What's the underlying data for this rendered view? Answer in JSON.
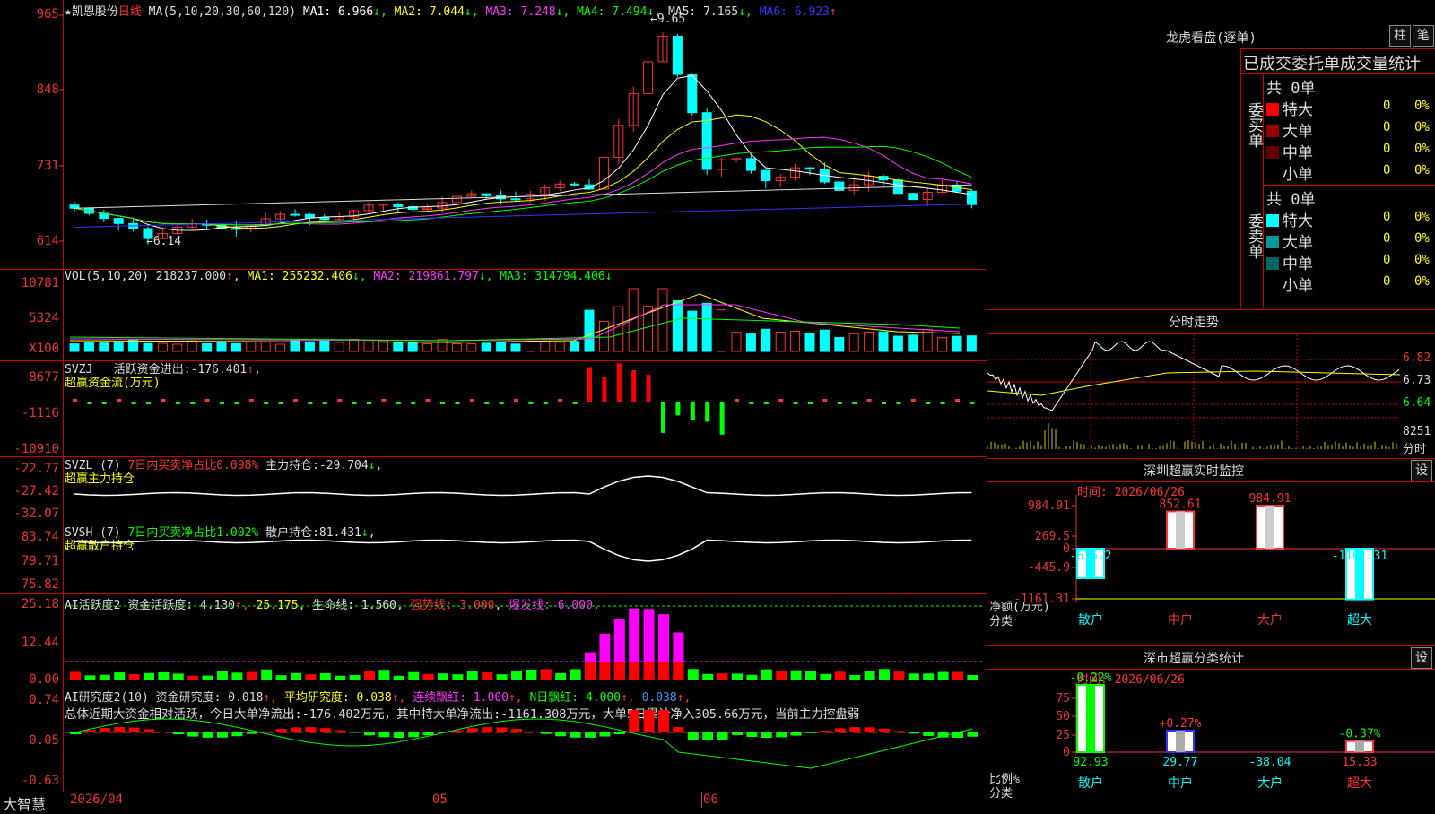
{
  "main": {
    "stock_name": "★凯恩股份",
    "period": "日线",
    "ma_label": "MA(5,10,20,30,60,120)",
    "ma": [
      {
        "name": "MA1:",
        "value": "6.966",
        "arrow": "↓",
        "color": "#ffffff"
      },
      {
        "name": "MA2:",
        "value": "7.044",
        "arrow": "↓",
        "color": "#ffff00"
      },
      {
        "name": "MA3:",
        "value": "7.248",
        "arrow": "↓",
        "color": "#ff33ff"
      },
      {
        "name": "MA4:",
        "value": "7.494",
        "arrow": "↓",
        "color": "#00ff00"
      },
      {
        "name": "MA5:",
        "value": "7.165",
        "arrow": "↓",
        "color": "#dddddd"
      },
      {
        "name": "MA6:",
        "value": "6.923",
        "arrow": "↑",
        "color": "#3333ff"
      }
    ],
    "y_labels": [
      "965",
      "848",
      "731",
      "614"
    ],
    "high_marker": "9.65",
    "low_marker": "6.14"
  },
  "vol": {
    "title": "VOL(5,10,20)",
    "value": "218237.000",
    "ma": [
      {
        "name": "MA1:",
        "value": "255232.406",
        "arrow": "↓",
        "color": "#ffff00"
      },
      {
        "name": "MA2:",
        "value": "219861.797",
        "arrow": "↓",
        "color": "#ff33ff"
      },
      {
        "name": "MA3:",
        "value": "314794.406",
        "arrow": "↓",
        "color": "#00ff00"
      }
    ],
    "y_labels": [
      "10781",
      "5324",
      "X100"
    ]
  },
  "svzj": {
    "title": "SVZJ",
    "line1_label": "活跃资金进出:",
    "line1_value": "-176.401",
    "line2": "超赢资金流(万元)",
    "y_labels": [
      "8677",
      "-1116",
      "-10910"
    ]
  },
  "svzl": {
    "title": "SVZL (7)",
    "seg1": "7日内买卖净占比0.098%",
    "seg2_label": "主力持仓:",
    "seg2_value": "-29.704",
    "line2": "超赢主力持仓",
    "y_labels": [
      "-22.77",
      "-27.42",
      "-32.07"
    ]
  },
  "svsh": {
    "title": "SVSH (7)",
    "seg1": "7日内买卖净占比1.002%",
    "seg2_label": "散户持仓:",
    "seg2_value": "81.431",
    "line2": "超赢散户持仓",
    "y_labels": [
      "83.74",
      "79.71",
      "75.82"
    ]
  },
  "ai1": {
    "title": "AI活跃度2",
    "items": [
      {
        "label": "资金活跃度:",
        "value": "4.130",
        "arrow": "↑",
        "color": "#dddddd"
      },
      {
        "label": "",
        "value": "25.175",
        "arrow": ",",
        "color": "#ffff00"
      },
      {
        "label": "生命线:",
        "value": "1.560",
        "arrow": ",",
        "color": "#dddddd"
      },
      {
        "label": "强势线:",
        "value": "3.000",
        "arrow": ",",
        "color": "#ff3333"
      },
      {
        "label": "爆发线:",
        "value": "6.000",
        "arrow": ",",
        "color": "#ff33ff"
      }
    ],
    "y_labels": [
      "25.18",
      "12.44",
      "0.00"
    ]
  },
  "ai2": {
    "title": "AI研究度2(10)",
    "items": [
      {
        "label": "资金研究度:",
        "value": "0.018",
        "arrow": "↑",
        "color": "#dddddd"
      },
      {
        "label": "平均研究度:",
        "value": "0.038",
        "arrow": "↑",
        "color": "#ffff00"
      },
      {
        "label": "连续飘红:",
        "value": "1.000",
        "arrow": "↑",
        "color": "#ff33ff"
      },
      {
        "label": "N日飘红:",
        "value": "4.000",
        "arrow": "↑",
        "color": "#00ff00"
      },
      {
        "label": "",
        "value": "0.038",
        "arrow": "↑",
        "color": "#3399ff"
      }
    ],
    "summary": "总体近期大资金相对活跃，今日大单净流出:-176.402万元，其中特大单净流出:-1161.308万元，大单5日累计净入305.66万元，当前主力控盘弱",
    "y_labels": [
      "0.74",
      "0.05",
      "-0.63"
    ]
  },
  "xaxis": {
    "labels": [
      "2026/04",
      "05",
      "06"
    ],
    "brand": "大智慧"
  },
  "dragon": {
    "title": "龙虎看盘(逐单)",
    "btn_bar": "柱",
    "btn_order": "笔",
    "header": "已成交委托单成交量统计",
    "buy_label": "委买单",
    "sell_label": "委卖单",
    "buy_total": "共 0单",
    "sell_total": "共 0单",
    "buy_rows": [
      {
        "name": "特大",
        "count": "0",
        "pct": "0%",
        "color": "#ff0000"
      },
      {
        "name": "大单",
        "count": "0",
        "pct": "0%",
        "color": "#990000"
      },
      {
        "name": "中单",
        "count": "0",
        "pct": "0%",
        "color": "#660000"
      },
      {
        "name": "小单",
        "count": "0",
        "pct": "0%",
        "color": "#000000"
      }
    ],
    "sell_rows": [
      {
        "name": "特大",
        "count": "0",
        "pct": "0%",
        "color": "#00ffff"
      },
      {
        "name": "大单",
        "count": "0",
        "pct": "0%",
        "color": "#009999"
      },
      {
        "name": "中单",
        "count": "0",
        "pct": "0%",
        "color": "#006666"
      },
      {
        "name": "小单",
        "count": "0",
        "pct": "0%",
        "color": "#000000"
      }
    ]
  },
  "intraday": {
    "title": "分时走势",
    "y_labels": [
      "6.82",
      "6.73",
      "6.64"
    ],
    "vol_label": "8251",
    "vol_unit": "分时"
  },
  "monitor": {
    "title": "深圳超赢实时监控",
    "btn": "设",
    "time": "时间: 2026/06/26",
    "y_labels": [
      "984.91",
      "269.5",
      "0",
      "-445.9",
      "-1161.31"
    ],
    "axis_label_1": "净额(万元)",
    "axis_label_2": "分类",
    "categories": [
      "散户",
      "中户",
      "大户",
      "超大"
    ],
    "values": [
      -676.2,
      852.61,
      984.91,
      -1161.31
    ],
    "value_labels": [
      "-676.2",
      "852.61",
      "984.91",
      "-1161.31"
    ]
  },
  "classify": {
    "title": "深市超赢分类统计",
    "btn": "设",
    "time": "时间: 2026/06/26",
    "y_labels": [
      "75",
      "50",
      "25",
      "0"
    ],
    "axis_label_1": "比例%",
    "axis_label_2": "分类",
    "categories": [
      "散户",
      "中户",
      "大户",
      "超大"
    ],
    "values": [
      92.93,
      29.77,
      -38.04,
      15.33
    ],
    "value_labels": [
      "92.93",
      "29.77",
      "-38.04",
      "15.33"
    ],
    "change_labels": [
      "-0.22%",
      "+0.27%",
      "",
      "-0.37%"
    ]
  }
}
